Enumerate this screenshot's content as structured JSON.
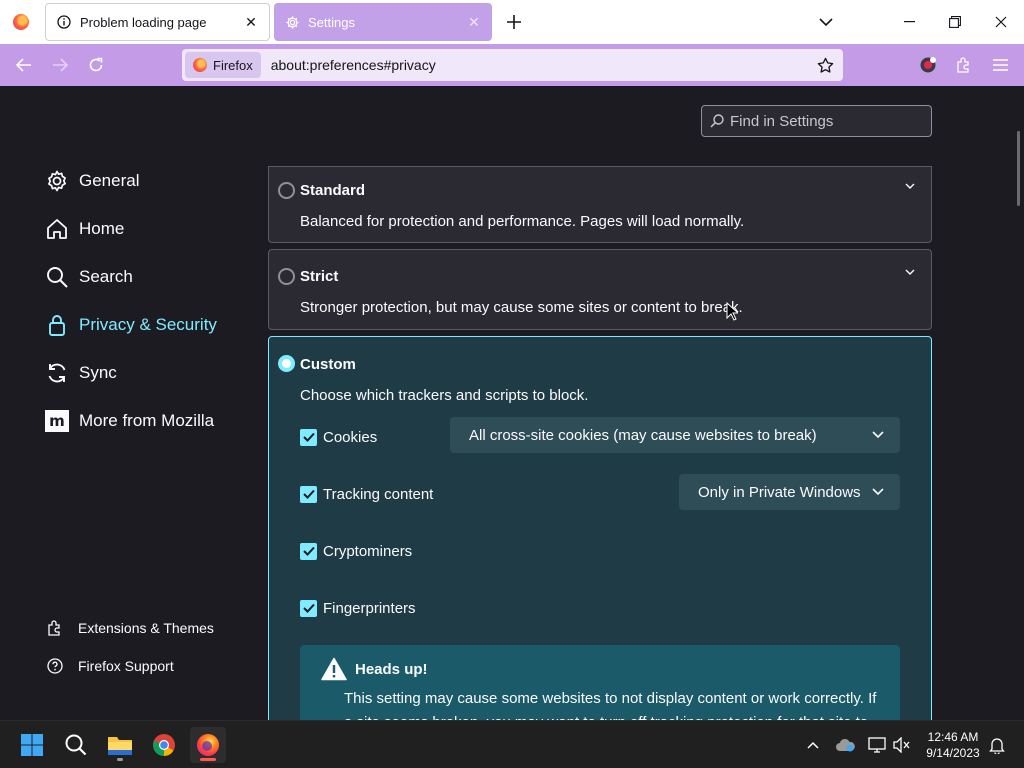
{
  "tabs": [
    {
      "title": "Problem loading page",
      "icon": "info-icon"
    },
    {
      "title": "Settings",
      "icon": "gear-icon"
    }
  ],
  "urlbar": {
    "identity_label": "Firefox",
    "url": "about:preferences#privacy"
  },
  "search": {
    "placeholder": "Find in Settings"
  },
  "sidebar": {
    "items": [
      {
        "label": "General",
        "icon": "gear-icon"
      },
      {
        "label": "Home",
        "icon": "home-icon"
      },
      {
        "label": "Search",
        "icon": "search-icon"
      },
      {
        "label": "Privacy & Security",
        "icon": "lock-icon",
        "active": true
      },
      {
        "label": "Sync",
        "icon": "sync-icon"
      },
      {
        "label": "More from Mozilla",
        "icon": "mozilla-icon"
      }
    ],
    "footer": [
      {
        "label": "Extensions & Themes",
        "icon": "puzzle-icon"
      },
      {
        "label": "Firefox Support",
        "icon": "help-icon"
      }
    ]
  },
  "protection": {
    "standard": {
      "title": "Standard",
      "desc": "Balanced for protection and performance. Pages will load normally."
    },
    "strict": {
      "title": "Strict",
      "desc": "Stronger protection, but may cause some sites or content to break."
    },
    "custom": {
      "title": "Custom",
      "desc": "Choose which trackers and scripts to block.",
      "options": [
        {
          "label": "Cookies",
          "checked": true,
          "dropdown": "All cross-site cookies (may cause websites to break)"
        },
        {
          "label": "Tracking content",
          "checked": true,
          "dropdown": "Only in Private Windows"
        },
        {
          "label": "Cryptominers",
          "checked": true
        },
        {
          "label": "Fingerprinters",
          "checked": true
        }
      ],
      "warning": {
        "title": "Heads up!",
        "text": "This setting may cause some websites to not display content or work correctly. If a site seems broken, you may want to turn off tracking protection for that site to"
      }
    }
  },
  "taskbar": {
    "apps": [
      "start-icon",
      "search-icon",
      "file-explorer-icon",
      "chrome-icon",
      "firefox-icon"
    ],
    "time": "12:46 AM",
    "date": "9/14/2023"
  },
  "colors": {
    "accent": "#80ebff",
    "toolbar": "#c49be6",
    "background": "#1c1b22"
  }
}
